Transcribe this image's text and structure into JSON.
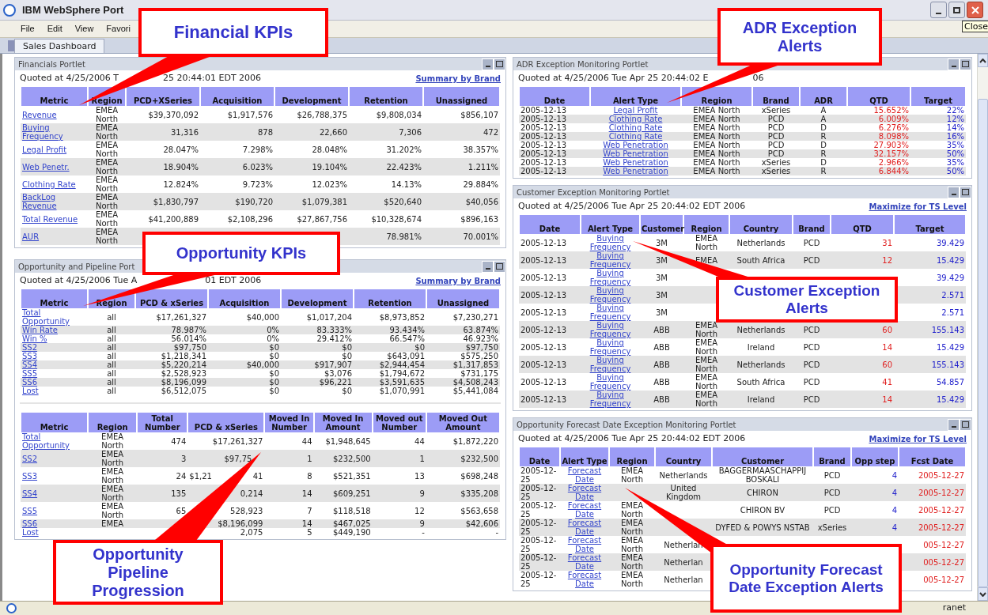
{
  "window": {
    "title": "IBM WebSphere Port",
    "tooltip": "Close"
  },
  "menu": [
    "File",
    "Edit",
    "View",
    "Favori"
  ],
  "tabs": [
    {
      "label": "Sales Dashboard",
      "selected": true
    }
  ],
  "left_portlets": [
    {
      "title": "Financials Portlet",
      "quoted": [
        "Quoted at 4/25/2006 T",
        "25 20:44:01 EDT 2006"
      ],
      "link": "Summary by Brand",
      "tables": [
        {
          "columns": [
            {
              "label": "Metric",
              "kind": "link"
            },
            {
              "label": "Region",
              "kind": "text"
            },
            {
              "label": "PCD+XSeries",
              "kind": "number"
            },
            {
              "label": "Acquisition",
              "kind": "number"
            },
            {
              "label": "Development",
              "kind": "number"
            },
            {
              "label": "Retention",
              "kind": "number"
            },
            {
              "label": "Unassigned",
              "kind": "number"
            }
          ],
          "rows": [
            [
              "Revenue",
              "EMEA North",
              "$39,370,092",
              "$1,917,576",
              "$26,788,375",
              "$9,808,034",
              "$856,107"
            ],
            [
              "Buying Frequency",
              "EMEA North",
              "31,316",
              "878",
              "22,660",
              "7,306",
              "472"
            ],
            [
              "Legal Profit",
              "EMEA North",
              "28.047%",
              "7.298%",
              "28.048%",
              "31.202%",
              "38.357%"
            ],
            [
              "Web Penetr.",
              "EMEA North",
              "18.904%",
              "6.023%",
              "19.104%",
              "22.423%",
              "1.211%"
            ],
            [
              "Clothing Rate",
              "EMEA North",
              "12.824%",
              "9.723%",
              "12.023%",
              "14.13%",
              "29.884%"
            ],
            [
              "BackLog Revenue",
              "EMEA North",
              "$1,830,797",
              "$190,720",
              "$1,079,381",
              "$520,640",
              "$40,056"
            ],
            [
              "Total Revenue",
              "EMEA North",
              "$41,200,889",
              "$2,108,296",
              "$27,867,756",
              "$10,328,674",
              "$896,163"
            ],
            [
              "AUR",
              "EMEA North",
              null,
              null,
              null,
              "78.981%",
              "70.001%"
            ]
          ]
        }
      ]
    },
    {
      "title": "Opportunity and Pipeline Port",
      "quoted": [
        "Quoted at 4/25/2006 Tue A",
        "01 EDT 2006"
      ],
      "link": "Summary by Brand",
      "tables": [
        {
          "columns": [
            {
              "label": "Metric",
              "kind": "link"
            },
            {
              "label": "Region",
              "kind": "text"
            },
            {
              "label": "PCD & xSeries",
              "kind": "number"
            },
            {
              "label": "Acquisition",
              "kind": "number"
            },
            {
              "label": "Development",
              "kind": "number"
            },
            {
              "label": "Retention",
              "kind": "number"
            },
            {
              "label": "Unassigned",
              "kind": "number"
            }
          ],
          "rows": [
            [
              "Total Opportunity",
              "all",
              "$17,261,327",
              "$40,000",
              "$1,017,204",
              "$8,973,852",
              "$7,230,271"
            ],
            [
              "Win Rate",
              "all",
              "78.987%",
              "0%",
              "83.333%",
              "93.434%",
              "63.874%"
            ],
            [
              "Win %",
              "all",
              "56.014%",
              "0%",
              "29.412%",
              "66.547%",
              "46.923%"
            ],
            [
              "SS2",
              "all",
              "$97,750",
              "$0",
              "$0",
              "$0",
              "$97,750"
            ],
            [
              "SS3",
              "all",
              "$1,218,341",
              "$0",
              "$0",
              "$643,091",
              "$575,250"
            ],
            [
              "SS4",
              "all",
              "$5,220,214",
              "$40,000",
              "$917,907",
              "$2,944,454",
              "$1,317,853"
            ],
            [
              "SS5",
              "all",
              "$2,528,923",
              "$0",
              "$3,076",
              "$1,794,672",
              "$731,175"
            ],
            [
              "SS6",
              "all",
              "$8,196,099",
              "$0",
              "$96,221",
              "$3,591,635",
              "$4,508,243"
            ],
            [
              "Lost",
              "all",
              "$6,512,075",
              "$0",
              "$0",
              "$1,070,991",
              "$5,441,084"
            ]
          ]
        },
        {
          "columns": [
            {
              "label": "Metric",
              "kind": "link"
            },
            {
              "label": "Region",
              "kind": "text"
            },
            {
              "label": "Total Number",
              "kind": "number"
            },
            {
              "label": "PCD & xSeries",
              "kind": "number"
            },
            {
              "label": "Moved In Number",
              "kind": "number"
            },
            {
              "label": "Moved In Amount",
              "kind": "number"
            },
            {
              "label": "Moved out Number",
              "kind": "number"
            },
            {
              "label": "Moved Out Amount",
              "kind": "number"
            }
          ],
          "rows": [
            [
              "Total Opportunity",
              "EMEA North",
              "474",
              "$17,261,327",
              "44",
              "$1,948,645",
              "44",
              "$1,872,220"
            ],
            [
              "SS2",
              "EMEA North",
              "3",
              [
                "$97,75"
              ],
              "1",
              "$232,500",
              "1",
              "$232,500"
            ],
            [
              "SS3",
              "EMEA North",
              "24",
              [
                "$1,21",
                "41"
              ],
              "8",
              "$521,351",
              "13",
              "$698,248"
            ],
            [
              "SS4",
              "EMEA North",
              "135",
              "0,214",
              "14",
              "$609,251",
              "9",
              "$335,208"
            ],
            [
              "SS5",
              "EMEA North",
              "65",
              "528,923",
              "7",
              "$118,518",
              "12",
              "$563,658"
            ],
            [
              "SS6",
              "EMEA",
              null,
              "$8,196,099",
              "14",
              "$467,025",
              "9",
              "$42,606"
            ],
            [
              "Lost",
              null,
              null,
              "2,075",
              "5",
              "$449,190",
              "-",
              "-"
            ]
          ]
        }
      ]
    }
  ],
  "right_portlets": [
    {
      "title": "ADR Exception Monitoring Portlet",
      "quoted": [
        "Quoted at 4/25/2006 Tue Apr 25 20:44:02 E",
        "06"
      ],
      "tables": [
        {
          "columns": [
            {
              "label": "Date",
              "kind": "date"
            },
            {
              "label": "Alert Type",
              "kind": "type-link"
            },
            {
              "label": "Region",
              "kind": "text"
            },
            {
              "label": "Brand",
              "kind": "text"
            },
            {
              "label": "ADR",
              "kind": "text"
            },
            {
              "label": "QTD",
              "kind": "alert"
            },
            {
              "label": "Target",
              "kind": "target"
            }
          ],
          "rows": [
            [
              "2005-12-13",
              "Legal Profit",
              "EMEA North",
              "xSeries",
              "A",
              "15.652%",
              "22%"
            ],
            [
              "2005-12-13",
              "Clothing Rate",
              "EMEA North",
              "PCD",
              "A",
              "6.009%",
              "12%"
            ],
            [
              "2005-12-13",
              "Clothing Rate",
              "EMEA North",
              "PCD",
              "D",
              "6.276%",
              "14%"
            ],
            [
              "2005-12-13",
              "Clothing Rate",
              "EMEA North",
              "PCD",
              "R",
              "8.098%",
              "16%"
            ],
            [
              "2005-12-13",
              "Web Penetration",
              "EMEA North",
              "PCD",
              "D",
              "27.903%",
              "35%"
            ],
            [
              "2005-12-13",
              "Web Penetration",
              "EMEA North",
              "PCD",
              "R",
              "32.157%",
              "50%"
            ],
            [
              "2005-12-13",
              "Web Penetration",
              "EMEA North",
              "xSeries",
              "D",
              "2.966%",
              "35%"
            ],
            [
              "2005-12-13",
              "Web Penetration",
              "EMEA North",
              "xSeries",
              "R",
              "6.844%",
              "50%"
            ]
          ]
        }
      ]
    },
    {
      "title": "Customer Exception Monitoring Portlet",
      "quoted": [
        "Quoted at 4/25/2006 Tue Apr 25 20:44:02 EDT 2006"
      ],
      "link": "Maximize for TS Level",
      "tables": [
        {
          "columns": [
            {
              "label": "Date",
              "kind": "date"
            },
            {
              "label": "Alert Type",
              "kind": "type-link"
            },
            {
              "label": "Customer",
              "kind": "text"
            },
            {
              "label": "Region",
              "kind": "text"
            },
            {
              "label": "Country",
              "kind": "text"
            },
            {
              "label": "Brand",
              "kind": "text"
            },
            {
              "label": "QTD",
              "kind": "alert"
            },
            {
              "label": "Target",
              "kind": "target"
            }
          ],
          "rows": [
            [
              "2005-12-13",
              "Buying Frequency",
              "3M",
              "EMEA North",
              "Netherlands",
              "PCD",
              "31",
              "39.429"
            ],
            [
              "2005-12-13",
              "Buying Frequency",
              "3M",
              "EMEA",
              "South Africa",
              "PCD",
              "12",
              "15.429"
            ],
            [
              "2005-12-13",
              "Buying Frequency",
              "3M",
              null,
              null,
              null,
              null,
              "39.429"
            ],
            [
              "2005-12-13",
              "Buying Frequency",
              "3M",
              null,
              null,
              null,
              null,
              "2.571"
            ],
            [
              "2005-12-13",
              "Buying Frequency",
              "3M",
              null,
              null,
              null,
              null,
              "2.571"
            ],
            [
              "2005-12-13",
              "Buying Frequency",
              "ABB",
              "EMEA North",
              "Netherlands",
              "PCD",
              "60",
              "155.143"
            ],
            [
              "2005-12-13",
              "Buying Frequency",
              "ABB",
              "EMEA North",
              "Ireland",
              "PCD",
              "14",
              "15.429"
            ],
            [
              "2005-12-13",
              "Buying Frequency",
              "ABB",
              "EMEA North",
              "Netherlands",
              "PCD",
              "60",
              "155.143"
            ],
            [
              "2005-12-13",
              "Buying Frequency",
              "ABB",
              "EMEA North",
              "South Africa",
              "PCD",
              "41",
              "54.857"
            ],
            [
              "2005-12-13",
              "Buying Frequency",
              "ABB",
              "EMEA North",
              "Ireland",
              "PCD",
              "14",
              "15.429"
            ]
          ]
        }
      ]
    },
    {
      "title": "Opportunity Forecast Date Exception Monitoring Portlet",
      "quoted": [
        "Quoted at 4/25/2006 Tue Apr 25 20:44:02 EDT 2006"
      ],
      "link": "Maximize for TS Level",
      "tables": [
        {
          "columns": [
            {
              "label": "Date",
              "kind": "date"
            },
            {
              "label": "Alert Type",
              "kind": "type-link"
            },
            {
              "label": "Region",
              "kind": "text"
            },
            {
              "label": "Country",
              "kind": "text"
            },
            {
              "label": "Customer",
              "kind": "text"
            },
            {
              "label": "Brand",
              "kind": "text"
            },
            {
              "label": "Opp step",
              "kind": "target"
            },
            {
              "label": "Fcst Date",
              "kind": "alert"
            }
          ],
          "rows": [
            [
              "2005-12-25",
              "Forecast Date",
              "EMEA North",
              "Netherlands",
              "BAGGERMAASCHAPPIJ BOSKALI",
              "PCD",
              "4",
              "2005-12-27"
            ],
            [
              "2005-12-25",
              "Forecast Date",
              null,
              "United Kingdom",
              "CHIRON",
              "PCD",
              "4",
              "2005-12-27"
            ],
            [
              "2005-12-25",
              "Forecast Date",
              "EMEA North",
              null,
              "CHIRON BV",
              "PCD",
              "4",
              "2005-12-27"
            ],
            [
              "2005-12-25",
              "Forecast Date",
              "EMEA North",
              null,
              "DYFED & POWYS NSTAB",
              "xSeries",
              "4",
              "2005-12-27"
            ],
            [
              "2005-12-25",
              "Forecast Date",
              "EMEA North",
              "Netherlan",
              null,
              null,
              null,
              "005-12-27"
            ],
            [
              "2005-12-25",
              "Forecast Date",
              "EMEA North",
              "Netherlan",
              null,
              null,
              null,
              "005-12-27"
            ],
            [
              "2005-12-25",
              "Forecast Date",
              "EMEA North",
              "Netherlan",
              null,
              null,
              null,
              "005-12-27"
            ]
          ]
        }
      ]
    }
  ],
  "status_bar": {
    "text": "ranet"
  },
  "callouts": [
    {
      "text": "Financial KPIs"
    },
    {
      "text": "Opportunity KPIs"
    },
    {
      "text": "Opportunity Pipeline Progression"
    },
    {
      "text": "ADR Exception Alerts"
    },
    {
      "text": "Customer Exception Alerts"
    },
    {
      "text": "Opportunity Forecast Date Exception Alerts"
    }
  ]
}
